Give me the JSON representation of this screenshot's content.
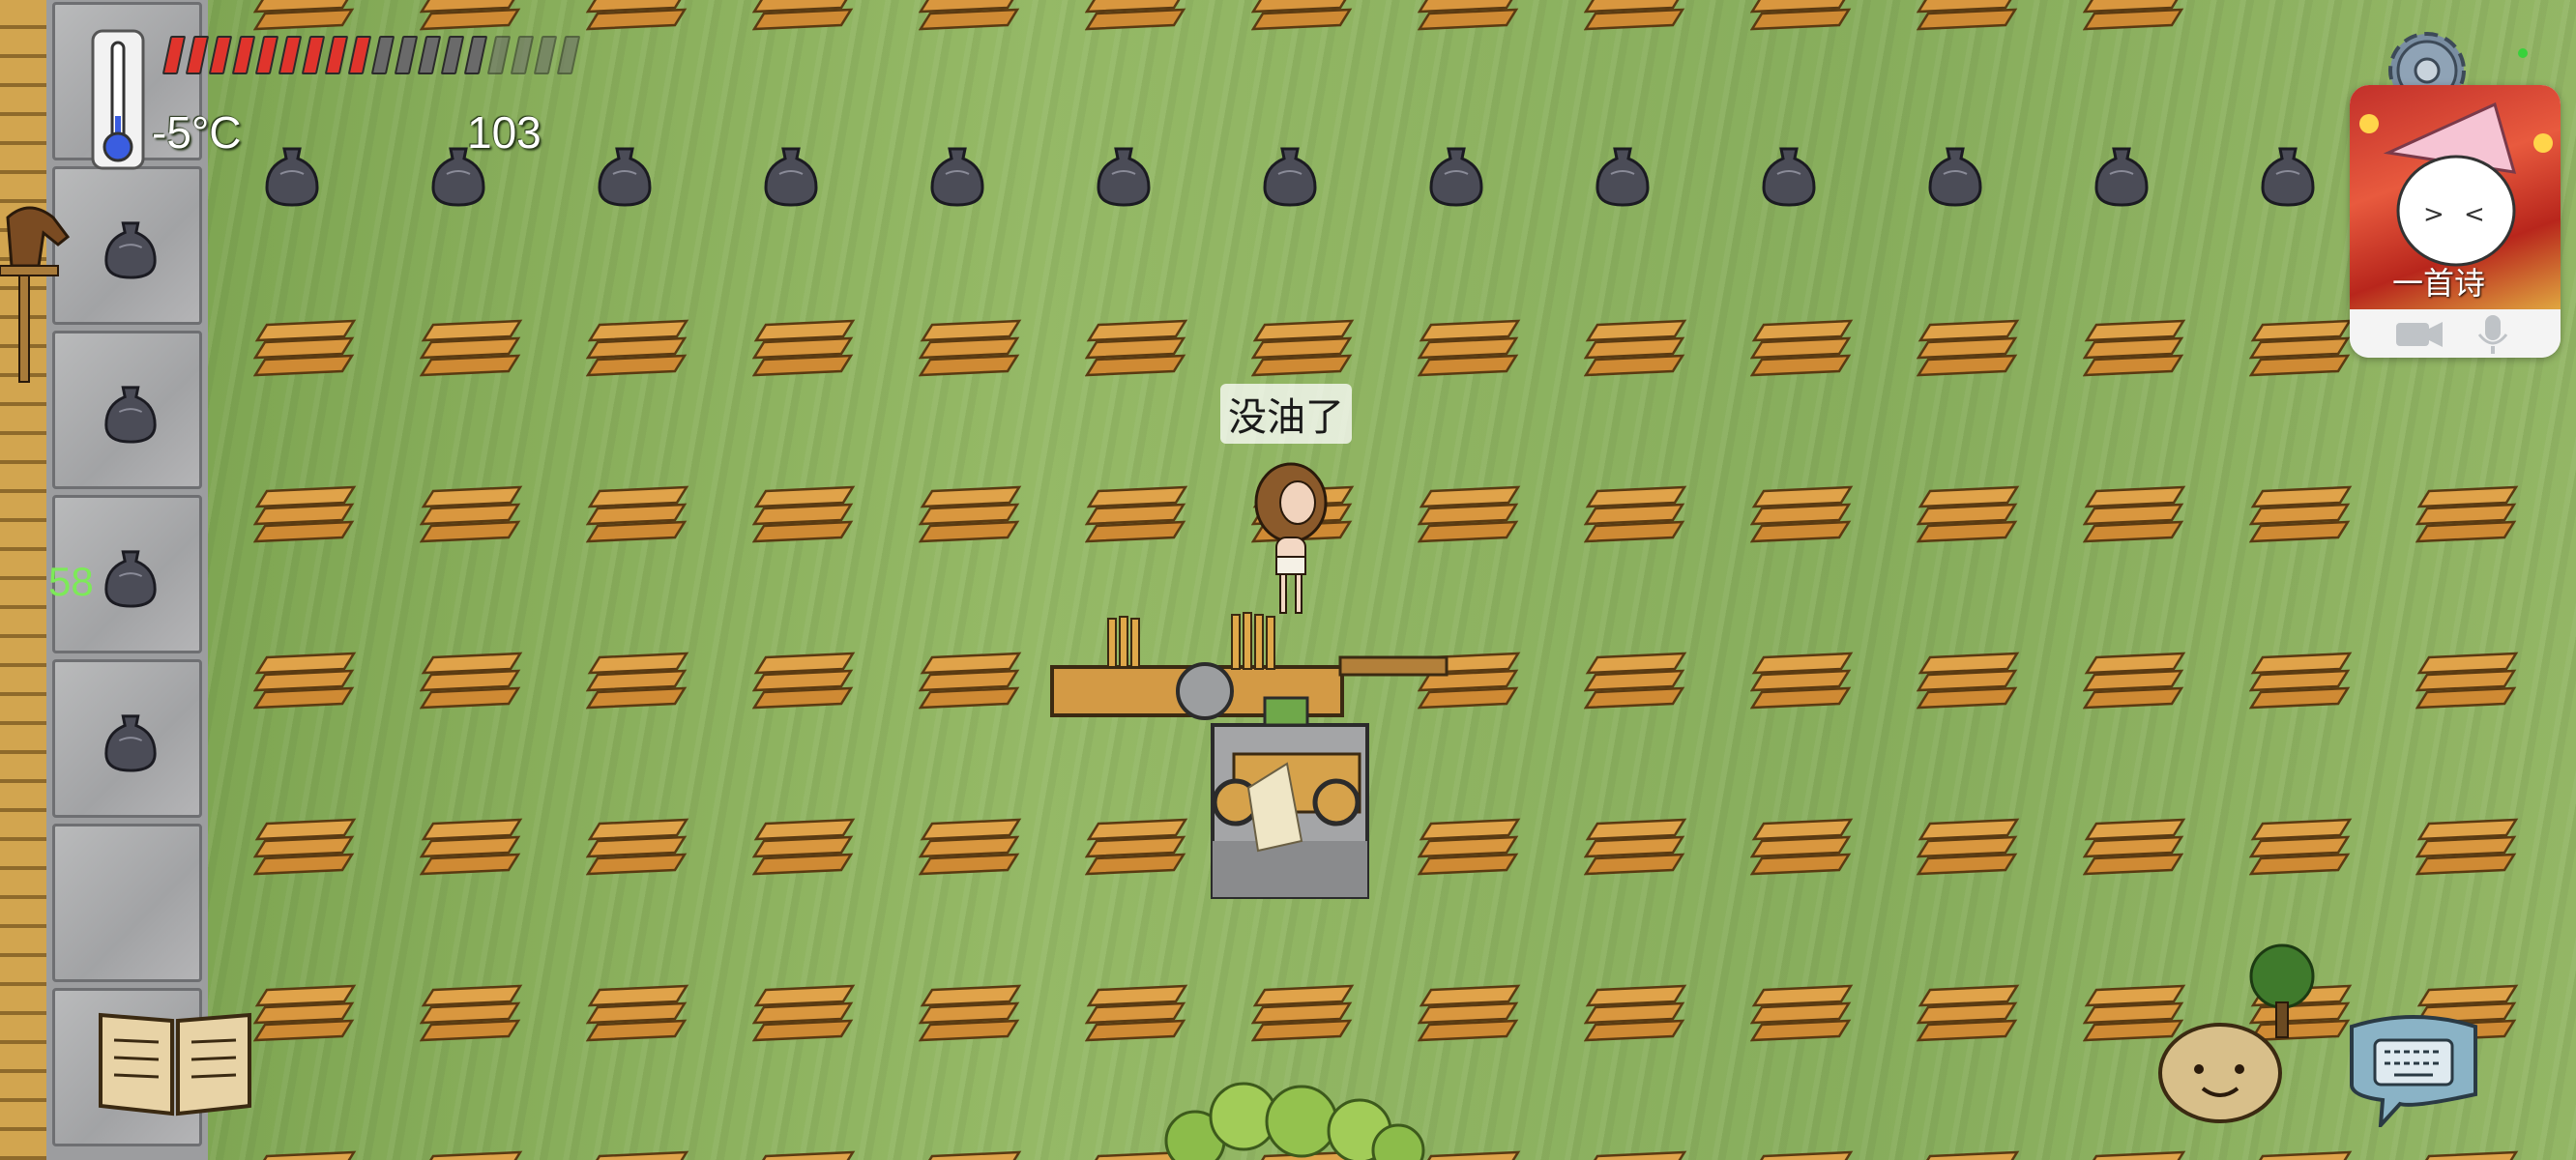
{
  "hud": {
    "temperature": "-5°C",
    "age": "103",
    "fps": "58",
    "food_filled": 9,
    "food_total": 18,
    "colors": {
      "food_filled": "#e0342c",
      "food_empty": "#6a6a6a",
      "fps_text": "#7dea58"
    }
  },
  "speech_bubble": {
    "text": "没油了"
  },
  "video_call": {
    "caption": "一首诗"
  },
  "icons": {
    "thermometer": "thermometer-icon",
    "settings": "gear-icon",
    "recipe_book": "book-icon",
    "emote": "potato-face-icon",
    "chat": "keyboard-speech-icon"
  }
}
